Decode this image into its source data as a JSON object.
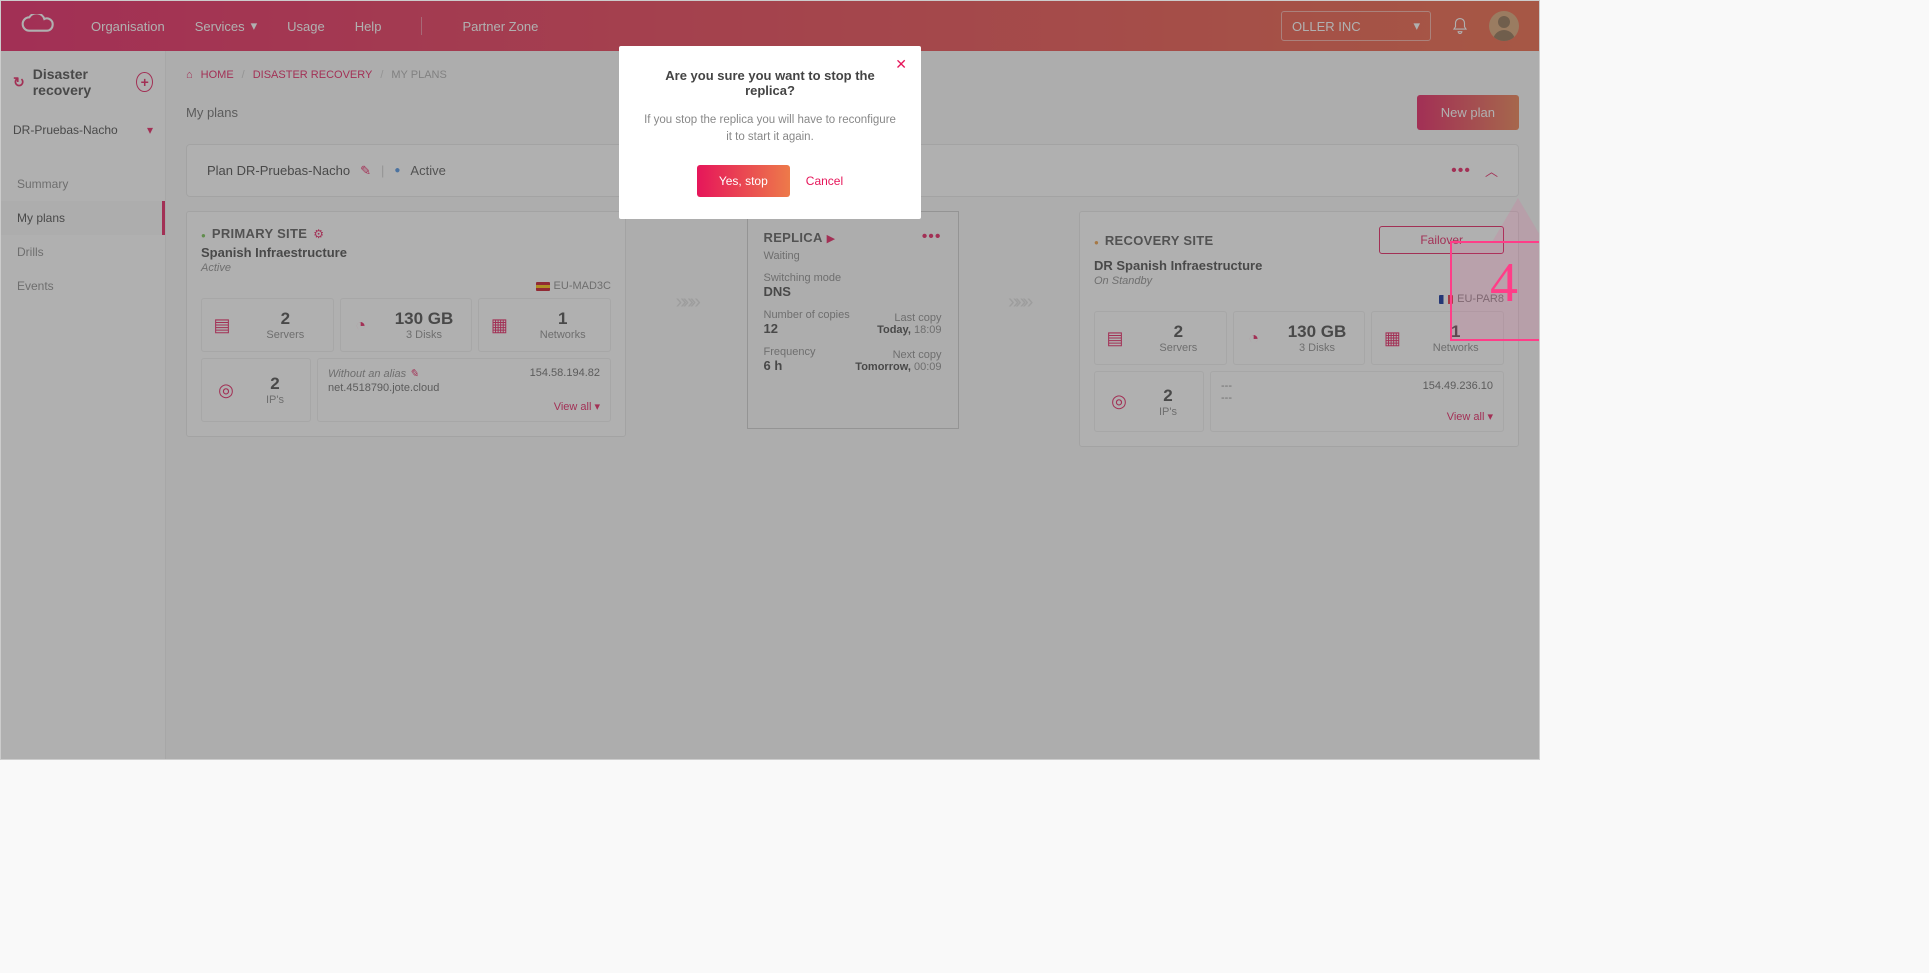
{
  "topnav": {
    "items": [
      "Organisation",
      "Services",
      "Usage",
      "Help"
    ],
    "partner": "Partner Zone",
    "org": "OLLER INC"
  },
  "sidebar": {
    "title": "Disaster recovery",
    "select": "DR-Pruebas-Nacho",
    "menu": [
      "Summary",
      "My plans",
      "Drills",
      "Events"
    ],
    "active_index": 1
  },
  "breadcrumb": {
    "home": "HOME",
    "dr": "DISASTER RECOVERY",
    "myplans": "MY PLANS"
  },
  "page": {
    "title": "My plans",
    "new_plan": "New plan"
  },
  "planbar": {
    "label": "Plan DR-Pruebas-Nacho",
    "status": "Active"
  },
  "primary": {
    "heading": "PRIMARY SITE",
    "sub1": "Spanish Infraestructure",
    "sub2": "Active",
    "region": "EU-MAD3C",
    "servers": "2",
    "servers_lbl": "Servers",
    "storage": "130 GB",
    "storage_lbl": "3 Disks",
    "networks": "1",
    "networks_lbl": "Networks",
    "ips": "2",
    "ips_lbl": "IP's",
    "alias": "Without an alias",
    "netid": "net.4518790.jote.cloud",
    "ip": "154.58.194.82",
    "viewall": "View all"
  },
  "replica": {
    "heading": "REPLICA",
    "status": "Waiting",
    "mode_k": "Switching mode",
    "mode_v": "DNS",
    "copies_k": "Number of copies",
    "copies_v": "12",
    "last_k": "Last copy",
    "last_v_day": "Today,",
    "last_v_time": "18:09",
    "freq_k": "Frequency",
    "freq_v": "6 h",
    "next_k": "Next copy",
    "next_v_day": "Tomorrow,",
    "next_v_time": "00:09"
  },
  "recovery": {
    "heading": "RECOVERY SITE",
    "sub1": "DR Spanish Infraestructure",
    "sub2": "On Standby",
    "region": "EU-PAR8",
    "servers": "2",
    "servers_lbl": "Servers",
    "storage": "130 GB",
    "storage_lbl": "3 Disks",
    "networks": "1",
    "networks_lbl": "Networks",
    "ips": "2",
    "ips_lbl": "IP's",
    "dash": "---",
    "ip": "154.49.236.10",
    "viewall": "View all",
    "failover": "Failover"
  },
  "modal": {
    "title": "Are you sure you want to stop the replica?",
    "msg": "If you stop the replica you will have to reconfigure it to start it again.",
    "yes": "Yes, stop",
    "cancel": "Cancel"
  },
  "annotation_num": "4"
}
